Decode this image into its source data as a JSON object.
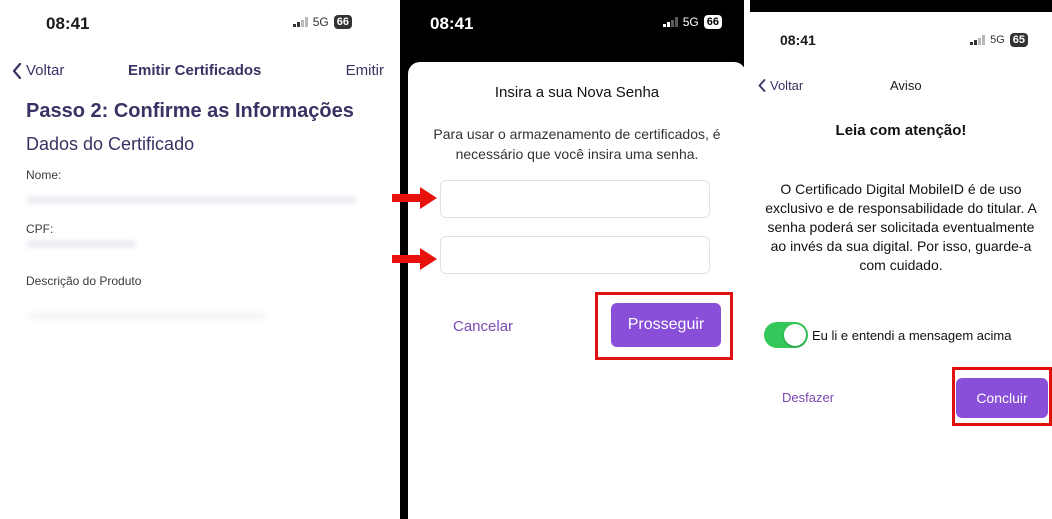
{
  "screen1": {
    "time": "08:41",
    "network": "5G",
    "battery": "66",
    "back_label": "Voltar",
    "nav_title": "Emitir Certificados",
    "nav_action": "Emitir",
    "step_title": "Passo 2: Confirme as Informações",
    "section_title": "Dados do Certificado",
    "fields": [
      {
        "label": "Nome:"
      },
      {
        "label": "CPF:"
      },
      {
        "label": "Descrição do Produto"
      }
    ]
  },
  "screen2": {
    "time": "08:41",
    "network": "5G",
    "battery": "66",
    "title": "Insira a sua Nova Senha",
    "description": "Para usar o armazenamento de certificados, é necessário que você insira uma senha.",
    "cancel_label": "Cancelar",
    "proceed_label": "Prosseguir"
  },
  "screen3": {
    "time": "08:41",
    "network": "5G",
    "battery": "65",
    "back_label": "Voltar",
    "nav_title": "Aviso",
    "heading": "Leia com atenção!",
    "body": "O Certificado Digital MobileID é de uso exclusivo e de responsabilidade do titular. A senha poderá ser solicitada eventualmente ao invés da sua digital. Por isso, guarde-a com cuidado.",
    "toggle_label": "Eu li e entendi a mensagem acima",
    "toggle_on": true,
    "undo_label": "Desfazer",
    "finish_label": "Concluir"
  },
  "colors": {
    "accent_purple": "#8a4fd9",
    "toggle_green": "#34c759",
    "highlight_red": "#e01010",
    "arrow_red": "#e8120c"
  }
}
